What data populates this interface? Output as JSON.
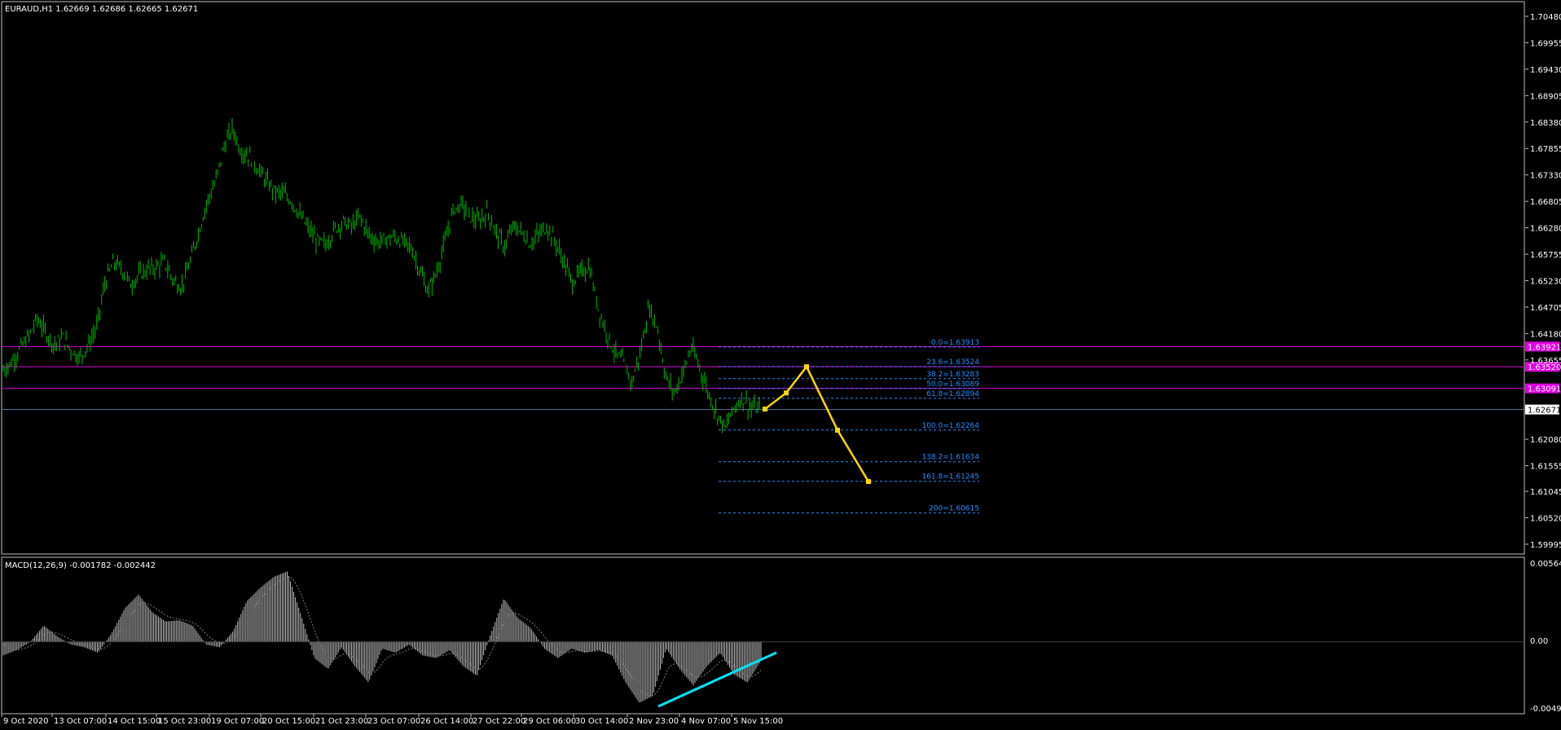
{
  "colors": {
    "background": "#000000",
    "frame": "#c0c0c0",
    "text": "#ffffff",
    "candle": "#00b800",
    "level_line": "#e000e0",
    "level_box": "#e000e0",
    "current_line": "#5a7aa8",
    "fib": "#1e90ff",
    "projection": "#ffd700",
    "macd_hist": "#c0c0c0",
    "macd_signal": "#808080",
    "trend_line": "#00e5ff"
  },
  "header": {
    "symbol_info": "EURAUD,H1  1.62669 1.62686 1.62665 1.62671"
  },
  "macd_panel": {
    "label": "MACD(12,26,9) -0.001782 -0.002442",
    "axis_top": "0.005641",
    "axis_zero": "0.00",
    "axis_bottom": "-0.004942"
  },
  "price_axis": {
    "ticks": [
      "1.70480",
      "1.69955",
      "1.69430",
      "1.68905",
      "1.68380",
      "1.67855",
      "1.67330",
      "1.66805",
      "1.66280",
      "1.65755",
      "1.65230",
      "1.64705",
      "1.64180",
      "1.63655",
      "1.62080",
      "1.61555",
      "1.61045",
      "1.60520",
      "1.59995"
    ],
    "level_labels": [
      "1.63921",
      "1.63520",
      "1.63091"
    ],
    "current_price": "1.62671"
  },
  "fib_levels": [
    {
      "label": "0.0=1.63913"
    },
    {
      "label": "23.6=1.63524"
    },
    {
      "label": "38.2=1.63283"
    },
    {
      "label": "50.0=1.63089"
    },
    {
      "label": "61.8=1.62894"
    },
    {
      "label": "100.0=1.62264"
    },
    {
      "label": "138.2=1.61634"
    },
    {
      "label": "161.8=1.61245"
    },
    {
      "label": "200=1.60615"
    }
  ],
  "time_axis": {
    "labels": [
      "9 Oct 2020",
      "13 Oct 07:00",
      "14 Oct 15:00",
      "15 Oct 23:00",
      "19 Oct 07:00",
      "20 Oct 15:00",
      "21 Oct 23:00",
      "23 Oct 07:00",
      "26 Oct 14:00",
      "27 Oct 22:00",
      "29 Oct 06:00",
      "30 Oct 14:00",
      "2 Nov 23:00",
      "4 Nov 07:00",
      "5 Nov 15:00"
    ]
  },
  "chart_data": {
    "type": "candlestick",
    "symbol": "EURAUD",
    "timeframe": "H1",
    "y_range": [
      1.59995,
      1.7048
    ],
    "close_path": [
      1.6345,
      1.6362,
      1.6388,
      1.6412,
      1.6448,
      1.642,
      1.6395,
      1.641,
      1.6385,
      1.637,
      1.6395,
      1.643,
      1.652,
      1.656,
      1.6545,
      1.6515,
      1.6535,
      1.6545,
      1.655,
      1.656,
      1.6525,
      1.651,
      1.656,
      1.662,
      1.668,
      1.672,
      1.679,
      1.6825,
      1.678,
      1.677,
      1.6745,
      1.672,
      1.67,
      1.6695,
      1.668,
      1.665,
      1.6625,
      1.66,
      1.6595,
      1.6625,
      1.664,
      1.663,
      1.665,
      1.6615,
      1.66,
      1.6605,
      1.661,
      1.66,
      1.659,
      1.6545,
      1.65,
      1.654,
      1.66,
      1.6665,
      1.6675,
      1.665,
      1.664,
      1.666,
      1.662,
      1.659,
      1.663,
      1.662,
      1.6595,
      1.6615,
      1.663,
      1.66,
      1.656,
      1.652,
      1.654,
      1.655,
      1.647,
      1.642,
      1.638,
      1.636,
      1.632,
      1.638,
      1.647,
      1.643,
      1.633,
      1.63,
      1.634,
      1.639,
      1.635,
      1.63,
      1.626,
      1.623,
      1.627,
      1.629,
      1.627,
      1.6267
    ],
    "horizontal_levels": [
      1.63921,
      1.6352,
      1.63091
    ],
    "current_price": 1.62671,
    "projection_points": [
      {
        "time": "5 Nov 22:00",
        "price": 1.6268
      },
      {
        "time": "6 Nov 03:00",
        "price": 1.63
      },
      {
        "time": "6 Nov 08:00",
        "price": 1.6352
      },
      {
        "time": "6 Nov 15:00",
        "price": 1.6226
      },
      {
        "time": "6 Nov 23:00",
        "price": 1.6124
      }
    ],
    "macd_hist_path": [
      -0.001,
      -0.0006,
      0.0,
      0.0012,
      0.0004,
      -0.0002,
      -0.0004,
      -0.0008,
      0.0006,
      0.0025,
      0.0035,
      0.0022,
      0.0015,
      0.0016,
      0.0012,
      -0.0002,
      -0.0004,
      0.0008,
      0.003,
      0.004,
      0.0048,
      0.0052,
      0.002,
      -0.0012,
      -0.002,
      -0.0004,
      -0.0018,
      -0.003,
      -0.0005,
      -0.0008,
      -0.0002,
      -0.001,
      -0.0012,
      -0.0006,
      -0.0018,
      -0.0025,
      0.0005,
      0.0032,
      0.0018,
      0.001,
      -0.0005,
      -0.0012,
      -0.0005,
      -0.0008,
      -0.0006,
      -0.001,
      -0.003,
      -0.0045,
      -0.004,
      -0.0005,
      -0.002,
      -0.0032,
      -0.0018,
      -0.0008,
      -0.0024,
      -0.003,
      -0.0014
    ]
  }
}
